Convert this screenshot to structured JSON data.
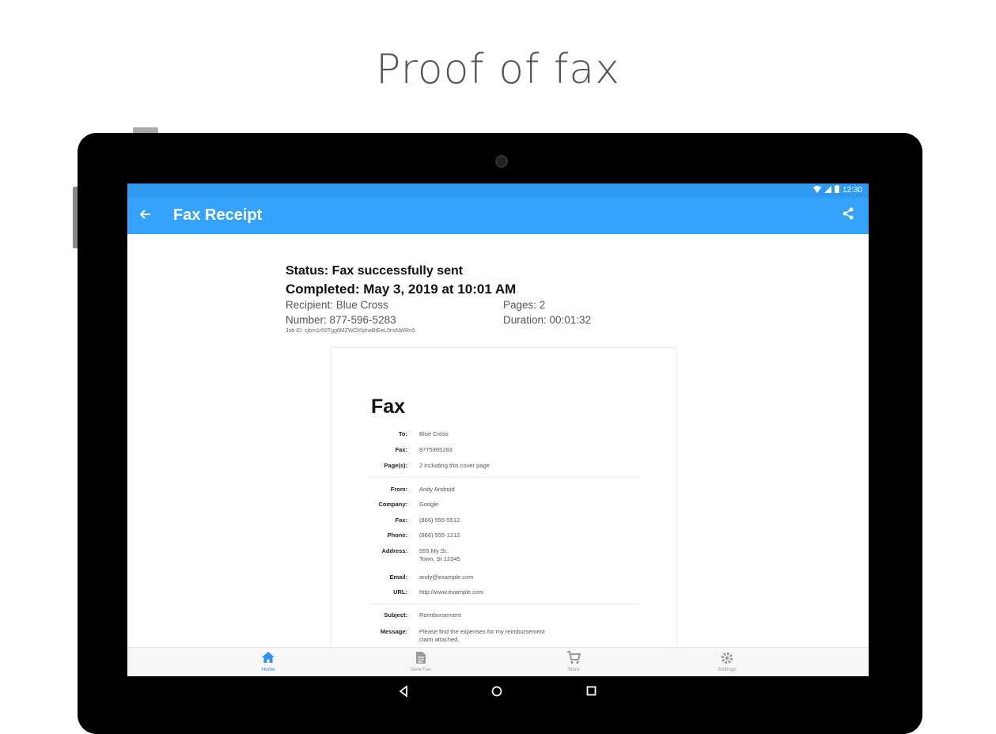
{
  "headline": "Proof of fax",
  "status_bar": {
    "time": "12:30"
  },
  "app_bar": {
    "title": "Fax Receipt"
  },
  "receipt": {
    "status": "Status: Fax successfully sent",
    "completed": "Completed: May 3, 2019 at 10:01 AM",
    "recipient": "Recipient: Blue Cross",
    "number": "Number:  877-596-5283",
    "pages": "Pages: 2",
    "duration": "Duration: 00:01:32",
    "job_id": "Job ID: cjbm1r59Tgg6MZWOXlphaBtEeL0nsNWRn5"
  },
  "cover_page": {
    "title": "Fax",
    "fields": [
      {
        "label": "To:",
        "value": "Blue Cross"
      },
      {
        "label": "Fax:",
        "value": "8775965283"
      },
      {
        "label": "Page(s):",
        "value": "2 including this cover page"
      },
      {
        "label": "From:",
        "value": "Andy Android"
      },
      {
        "label": "Company:",
        "value": "Google"
      },
      {
        "label": "Fax:",
        "value": "(866) 555-5512"
      },
      {
        "label": "Phone:",
        "value": "(866) 555-1212"
      },
      {
        "label": "Address:",
        "value": "555 My St.",
        "value2": "Town, St 12345"
      },
      {
        "label": "Email:",
        "value": "andy@example.com"
      },
      {
        "label": "URL:",
        "value": "http://www.example.com"
      },
      {
        "label": "Subject:",
        "value": "Reimbursement"
      },
      {
        "label": "Message:",
        "value": "Please find the expenses for my reimbursement",
        "value2": "claim attached."
      }
    ]
  },
  "bottom_nav": {
    "items": [
      {
        "label": "Home",
        "icon": "home-icon"
      },
      {
        "label": "New Fax",
        "icon": "document-icon"
      },
      {
        "label": "Store",
        "icon": "cart-icon"
      },
      {
        "label": "Settings",
        "icon": "gear-icon"
      }
    ]
  },
  "colors": {
    "accent": "#35a2fb",
    "status_bar": "#2e9bf0",
    "active_nav": "#2e8ff0"
  }
}
